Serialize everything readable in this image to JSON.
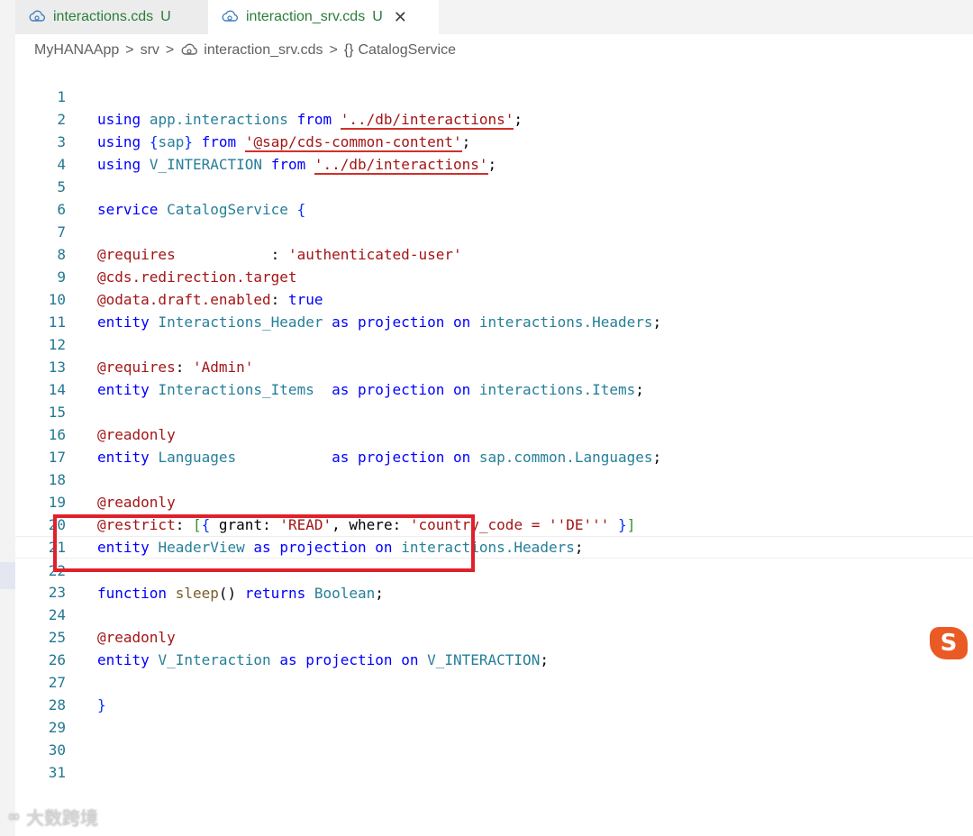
{
  "tabs": [
    {
      "label": "interactions.cds",
      "status": "U",
      "active": false
    },
    {
      "label": "interaction_srv.cds",
      "status": "U",
      "active": true,
      "close": "✕"
    }
  ],
  "breadcrumb": {
    "items": [
      "MyHANAApp",
      "srv",
      "interaction_srv.cds",
      "CatalogService"
    ],
    "separator": ">",
    "symbol_glyph": "{}"
  },
  "editor": {
    "line_numbers": [
      "1",
      "2",
      "3",
      "4",
      "5",
      "6",
      "7",
      "8",
      "9",
      "10",
      "11",
      "12",
      "13",
      "14",
      "15",
      "16",
      "17",
      "18",
      "19",
      "20",
      "21",
      "22",
      "23",
      "24",
      "25",
      "26",
      "27",
      "28",
      "29",
      "30",
      "31"
    ],
    "lines": [
      "using app.interactions from '../db/interactions';",
      "using {sap} from '@sap/cds-common-content';",
      "using V_INTERACTION from '../db/interactions';",
      "",
      "service CatalogService {",
      "",
      "@requires           : 'authenticated-user'",
      "@cds.redirection.target",
      "@odata.draft.enabled: true",
      "entity Interactions_Header as projection on interactions.Headers;",
      "",
      "@requires: 'Admin'",
      "entity Interactions_Items  as projection on interactions.Items;",
      "",
      "@readonly",
      "entity Languages           as projection on sap.common.Languages;",
      "",
      "@readonly",
      "@restrict: [{ grant: 'READ', where: 'country_code = ''DE''' }]",
      "entity HeaderView as projection on interactions.Headers;",
      "",
      "function sleep() returns Boolean;",
      "",
      "@readonly",
      "entity V_Interaction as projection on V_INTERACTION;",
      "",
      "}",
      "",
      "",
      "",
      ""
    ],
    "current_line": 22
  },
  "colors": {
    "keyword": "#0000ff",
    "type_name": "#267f99",
    "string": "#a31515",
    "line_number": "#237893",
    "highlight_box": "#e0202a",
    "tab_label": "#2a7d3a"
  },
  "overlay": {
    "ime_icon": "S",
    "watermark": "大数跨境"
  }
}
